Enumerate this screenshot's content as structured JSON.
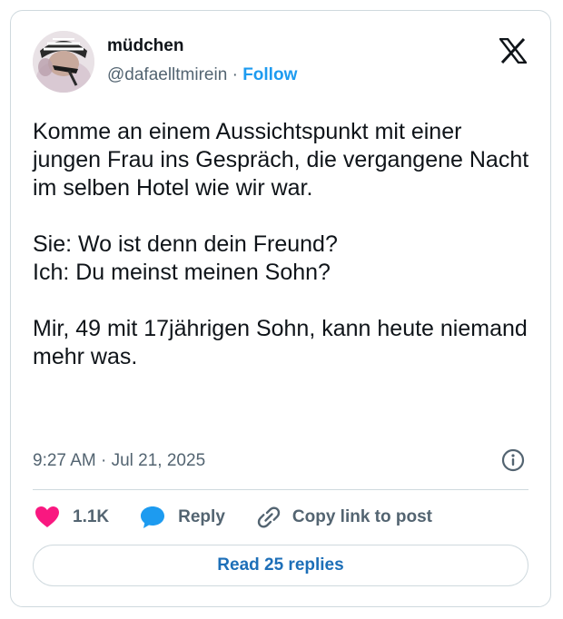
{
  "author": {
    "display_name": "müdchen",
    "handle": "@dafaelltmirein",
    "separator": "·",
    "follow_label": "Follow"
  },
  "tweet": {
    "text": "Komme an einem Aussichtspunkt mit einer jungen Frau ins Gespräch, die vergangene Nacht im selben Hotel wie wir war.\n\nSie: Wo ist denn dein Freund?\nIch: Du meinst meinen Sohn?\n\nMir, 49 mit 17jährigen Sohn, kann heute niemand mehr was.",
    "time": "9:27 AM",
    "separator": "·",
    "date": "Jul 21, 2025"
  },
  "actions": {
    "likes": "1.1K",
    "reply_label": "Reply",
    "copy_label": "Copy link to post"
  },
  "footer": {
    "read_replies_label": "Read 25 replies"
  },
  "icons": {
    "logo": "x-logo-icon",
    "info": "info-icon",
    "like": "heart-icon",
    "reply": "speech-bubble-icon",
    "copy": "link-icon"
  },
  "colors": {
    "accent": "#1d9bf0",
    "heart": "#f91880",
    "muted": "#536471",
    "border": "#cfd9de"
  }
}
